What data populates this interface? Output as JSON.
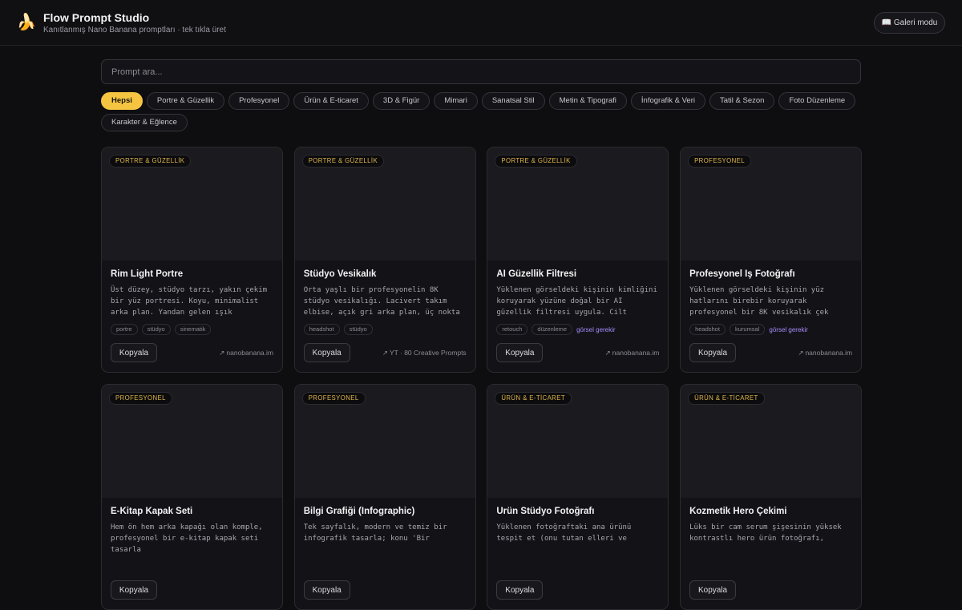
{
  "header": {
    "logo": "🍌",
    "title": "Flow Prompt Studio",
    "subtitle": "Kanıtlanmış Nano Banana promptları · tek tıkla üret",
    "gallery_button": "📖 Galeri modu"
  },
  "search": {
    "placeholder": "Prompt ara..."
  },
  "filters": [
    "Hepsi",
    "Portre & Güzellik",
    "Profesyonel",
    "Ürün & E-ticaret",
    "3D & Figür",
    "Mimari",
    "Sanatsal Stil",
    "Metin & Tipografi",
    "İnfografik & Veri",
    "Tatil & Sezon",
    "Foto Düzenleme",
    "Karakter & Eğlence"
  ],
  "active_filter": "Hepsi",
  "copy_label": "Kopyala",
  "needs_image_label": "görsel gerekir",
  "cards": [
    {
      "badge": "PORTRE & GÜZELLİK",
      "title": "Rim Light Portre",
      "desc": "Üst düzey, stüdyo tarzı, yakın çekim bir yüz portresi. Koyu, minimalist arka plan. Yandan gelen ışık",
      "tags": [
        "portre",
        "stüdyo",
        "sinematik"
      ],
      "needs_image": false,
      "source": "nanobanana.im"
    },
    {
      "badge": "PORTRE & GÜZELLİK",
      "title": "Stüdyo Vesikalık",
      "desc": "Orta yaşlı bir profesyonelin 8K stüdyo vesikalığı. Lacivert takım elbise, açık gri arka plan, üç nokta",
      "tags": [
        "headshot",
        "stüdyo"
      ],
      "needs_image": false,
      "source": "YT · 80 Creative Prompts"
    },
    {
      "badge": "PORTRE & GÜZELLİK",
      "title": "AI Güzellik Filtresi",
      "desc": "Yüklenen görseldeki kişinin kimliğini koruyarak yüzüne doğal bir AI güzellik filtresi uygula. Cilt",
      "tags": [
        "retouch",
        "düzenleme"
      ],
      "needs_image": true,
      "source": "nanobanana.im"
    },
    {
      "badge": "PROFESYONEL",
      "title": "Profesyonel İş Fotoğrafı",
      "desc": "Yüklenen görseldeki kişinin yüz hatlarını birebir koruyarak profesyonel bir 8K vesikalık çek",
      "tags": [
        "headshot",
        "kurumsal"
      ],
      "needs_image": true,
      "source": "nanobanana.im"
    },
    {
      "badge": "PROFESYONEL",
      "title": "E-Kitap Kapak Seti",
      "desc": "Hem ön hem arka kapağı olan komple, profesyonel bir e-kitap kapak seti tasarla",
      "tags": [],
      "needs_image": false,
      "source": ""
    },
    {
      "badge": "PROFESYONEL",
      "title": "Bilgi Grafiği (Infographic)",
      "desc": "Tek sayfalık, modern ve temiz bir infografik tasarla; konu 'Bir",
      "tags": [],
      "needs_image": false,
      "source": ""
    },
    {
      "badge": "ÜRÜN & E-TİCARET",
      "title": "Ürün Stüdyo Fotoğrafı",
      "desc": "Yüklenen fotoğraftaki ana ürünü tespit et (onu tutan elleri ve",
      "tags": [],
      "needs_image": false,
      "source": ""
    },
    {
      "badge": "ÜRÜN & E-TİCARET",
      "title": "Kozmetik Hero Çekimi",
      "desc": "Lüks bir cam serum şişesinin yüksek kontrastlı hero ürün fotoğrafı,",
      "tags": [],
      "needs_image": false,
      "source": ""
    }
  ],
  "colors": {
    "accent": "#f5c542",
    "background": "#0e0e11",
    "card": "#131317",
    "badge_text": "#e0b64a",
    "needs_image": "#a78bfa"
  }
}
